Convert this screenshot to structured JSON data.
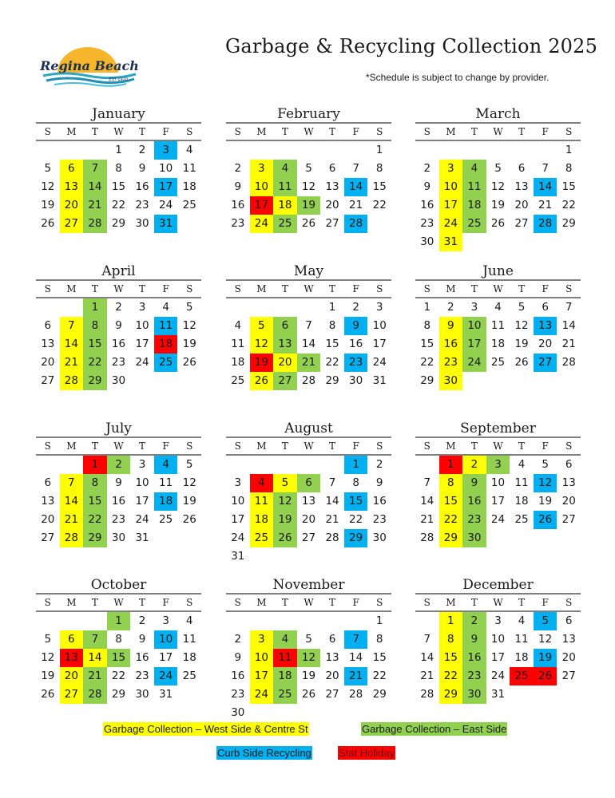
{
  "header": {
    "logo_text": "Regina Beach",
    "logo_est": "EST 1920",
    "title": "Garbage & Recycling Collection 2025",
    "subtitle": "*Schedule is subject to change by provider."
  },
  "colors": {
    "garbage_west": "#ffff00",
    "garbage_east": "#92d050",
    "recycling": "#00b0f0",
    "holiday": "#ff0000"
  },
  "weekdays": [
    "S",
    "M",
    "T",
    "W",
    "T",
    "F",
    "S"
  ],
  "months": [
    {
      "name": "January",
      "start": 3,
      "days": 31,
      "yellow": [
        6,
        13,
        20,
        27
      ],
      "green": [
        7,
        14,
        21,
        28
      ],
      "blue": [
        3,
        17,
        31
      ],
      "red": []
    },
    {
      "name": "February",
      "start": 6,
      "days": 28,
      "yellow": [
        3,
        10,
        18,
        24
      ],
      "green": [
        4,
        11,
        19,
        25
      ],
      "blue": [
        14,
        28
      ],
      "red": [
        17
      ]
    },
    {
      "name": "March",
      "start": 6,
      "days": 31,
      "yellow": [
        3,
        10,
        17,
        24,
        31
      ],
      "green": [
        4,
        11,
        18,
        25
      ],
      "blue": [
        14,
        28
      ],
      "red": []
    },
    {
      "name": "April",
      "start": 2,
      "days": 30,
      "yellow": [
        7,
        14,
        21,
        28
      ],
      "green": [
        1,
        8,
        15,
        22,
        29
      ],
      "blue": [
        11,
        25
      ],
      "red": [
        18
      ]
    },
    {
      "name": "May",
      "start": 4,
      "days": 31,
      "yellow": [
        5,
        12,
        20,
        26
      ],
      "green": [
        6,
        13,
        21,
        27
      ],
      "blue": [
        9,
        23
      ],
      "red": [
        19
      ]
    },
    {
      "name": "June",
      "start": 0,
      "days": 30,
      "yellow": [
        9,
        16,
        23,
        30
      ],
      "green": [
        10,
        17,
        24
      ],
      "blue": [
        13,
        27
      ],
      "red": []
    },
    {
      "name": "July",
      "start": 2,
      "days": 31,
      "yellow": [
        7,
        14,
        21,
        28
      ],
      "green": [
        2,
        8,
        15,
        22,
        29
      ],
      "blue": [
        4,
        18
      ],
      "red": [
        1
      ]
    },
    {
      "name": "August",
      "start": 5,
      "days": 31,
      "yellow": [
        5,
        11,
        18,
        25
      ],
      "green": [
        6,
        12,
        19,
        26
      ],
      "blue": [
        1,
        15,
        29
      ],
      "red": [
        4
      ]
    },
    {
      "name": "September",
      "start": 1,
      "days": 30,
      "yellow": [
        2,
        8,
        15,
        22,
        29
      ],
      "green": [
        3,
        9,
        16,
        23,
        30
      ],
      "blue": [
        12,
        26
      ],
      "red": [
        1
      ]
    },
    {
      "name": "October",
      "start": 3,
      "days": 31,
      "yellow": [
        6,
        14,
        20,
        27
      ],
      "green": [
        1,
        7,
        15,
        21,
        28
      ],
      "blue": [
        10,
        24
      ],
      "red": [
        13
      ]
    },
    {
      "name": "November",
      "start": 6,
      "days": 30,
      "yellow": [
        3,
        10,
        17,
        24
      ],
      "green": [
        4,
        12,
        18,
        25
      ],
      "blue": [
        7,
        21
      ],
      "red": [
        11
      ]
    },
    {
      "name": "December",
      "start": 1,
      "days": 31,
      "yellow": [
        1,
        8,
        15,
        22,
        29
      ],
      "green": [
        2,
        9,
        16,
        23,
        30
      ],
      "blue": [
        5,
        19
      ],
      "red": [
        25,
        26
      ]
    }
  ],
  "legend": {
    "garbage_west": "Garbage Collection – West Side & Centre St",
    "garbage_east": "Garbage Collection – East Side",
    "recycling": "Curb Side Recycling",
    "holiday": "Stat Holiday"
  }
}
